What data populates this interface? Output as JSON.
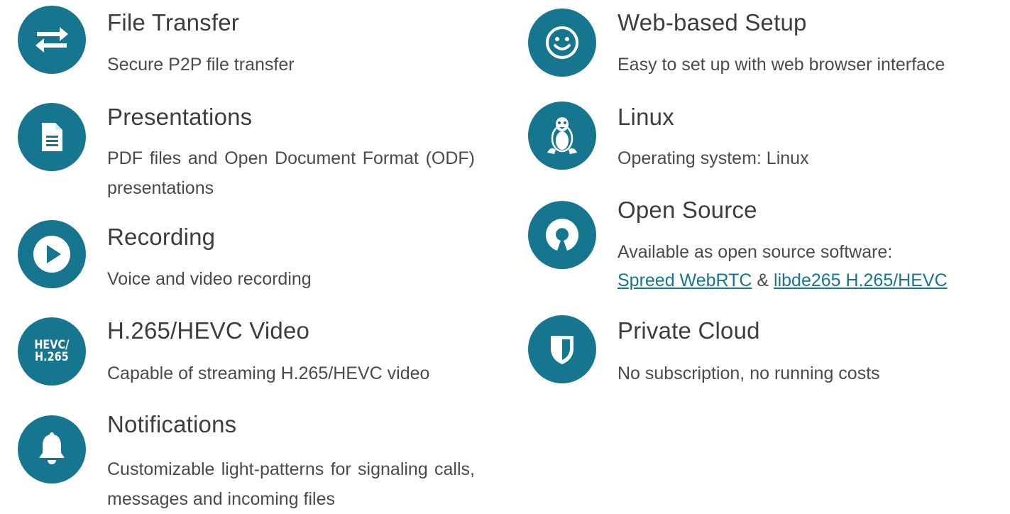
{
  "colors": {
    "accent": "#17768f",
    "title_text": "#3d3d3d",
    "body_text": "#4a4a4a",
    "background": "#ffffff"
  },
  "features_left": [
    {
      "icon": "transfer-arrows-icon",
      "title": "File Transfer",
      "description": "Secure P2P file transfer"
    },
    {
      "icon": "document-icon",
      "title": "Presentations",
      "description": "PDF files and Open Document Format (ODF) presentations"
    },
    {
      "icon": "play-icon",
      "title": "Recording",
      "description": "Voice and video recording"
    },
    {
      "icon": "hevc-icon",
      "icon_label": "HEVC/\nH.265",
      "title": "H.265/HEVC Video",
      "description": "Capable of streaming H.265/HEVC video"
    },
    {
      "icon": "bell-icon",
      "title": "Notifications",
      "description": "Customizable light-patterns for signaling calls, messages and incoming files"
    }
  ],
  "features_right": [
    {
      "icon": "smiley-icon",
      "title": "Web-based Setup",
      "description": "Easy to set up with web browser interface"
    },
    {
      "icon": "linux-penguin-icon",
      "title": "Linux",
      "description": "Operating system: Linux"
    },
    {
      "icon": "open-source-icon",
      "title": "Open Source",
      "description": "Available as open source software:",
      "link1": "Spreed WebRTC",
      "separator": "&",
      "link2": "libde265 H.265/HEVC"
    },
    {
      "icon": "shield-icon",
      "title": "Private Cloud",
      "description": "No subscription, no running costs"
    }
  ]
}
